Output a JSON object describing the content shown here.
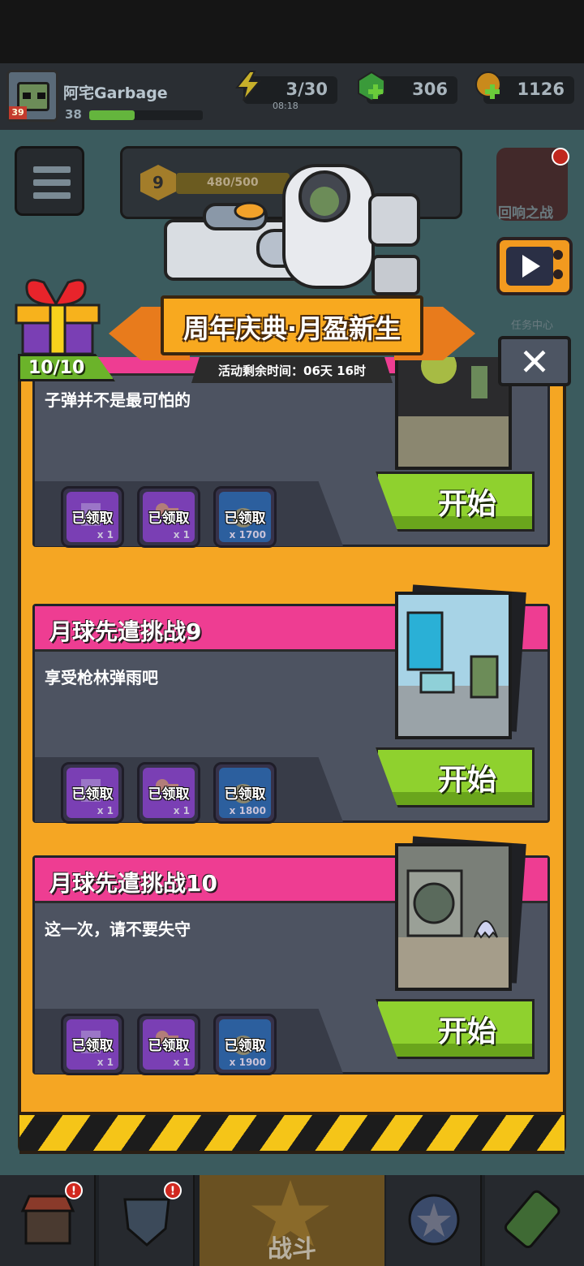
{
  "hud": {
    "player_name": "阿宅Garbage",
    "player_level": "38",
    "avatar_level": "39",
    "energy": "3/30",
    "energy_timer": "08:18",
    "gems": "306",
    "coins": "1126"
  },
  "scene": {
    "season_level": "9",
    "season_progress": "480/500",
    "echo_battle_label": "回响之战",
    "task_center_label": "任务中心"
  },
  "dialog": {
    "banner_title": "周年庆典·月盈新生",
    "timer_text": "活动剩余时间：06天 16时",
    "gift_count": "10/10",
    "close_symbol": "✕",
    "cards": [
      {
        "title": "",
        "desc": "子弹并不是最可怕的",
        "start_label": "开始",
        "rewards": [
          {
            "status": "已领取",
            "qty": "x 1",
            "type": "chip"
          },
          {
            "status": "已领取",
            "qty": "x 1",
            "type": "key"
          },
          {
            "status": "已领取",
            "qty": "x 1700",
            "type": "bag"
          }
        ]
      },
      {
        "title": "月球先遣挑战9",
        "desc": "享受枪林弹雨吧",
        "start_label": "开始",
        "rewards": [
          {
            "status": "已领取",
            "qty": "x 1",
            "type": "chip"
          },
          {
            "status": "已领取",
            "qty": "x 1",
            "type": "key"
          },
          {
            "status": "已领取",
            "qty": "x 1800",
            "type": "bag"
          }
        ]
      },
      {
        "title": "月球先遣挑战10",
        "desc": "这一次，请不要失守",
        "start_label": "开始",
        "rewards": [
          {
            "status": "已领取",
            "qty": "x 1",
            "type": "chip"
          },
          {
            "status": "已领取",
            "qty": "x 1",
            "type": "key"
          },
          {
            "status": "已领取",
            "qty": "x 1900",
            "type": "bag"
          }
        ]
      }
    ]
  },
  "bottom_nav": {
    "battle_label": "战斗"
  },
  "colors": {
    "accent_orange": "#f5a623",
    "title_pink": "#ee3d92",
    "start_green": "#8fd12e",
    "panel_gray": "#4d5361"
  }
}
